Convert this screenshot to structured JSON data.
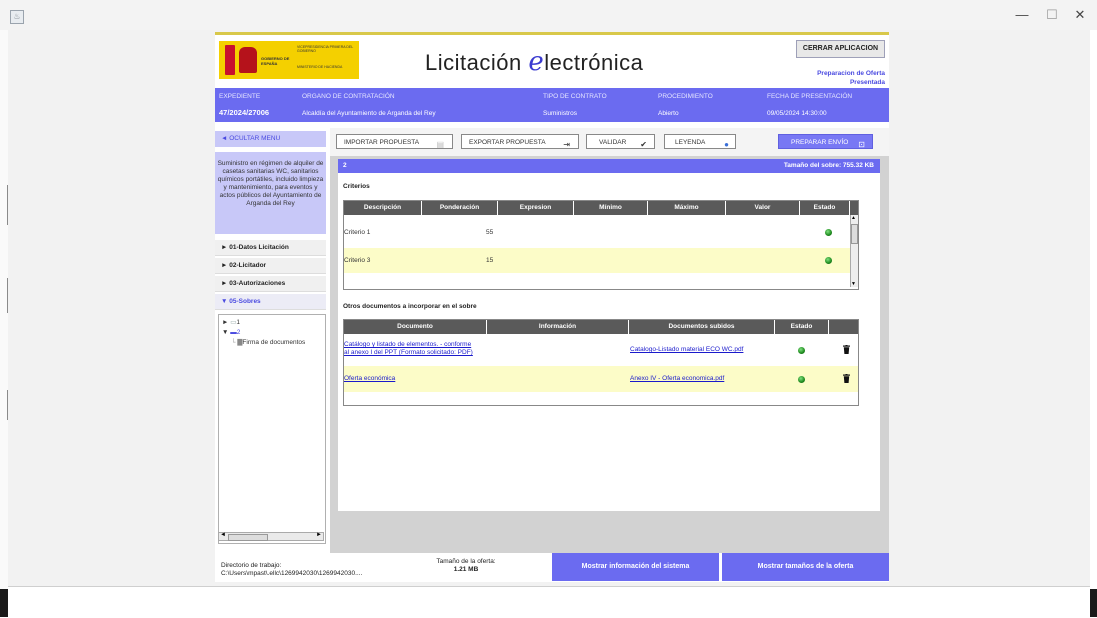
{
  "window": {
    "controls": {
      "minimize": "—",
      "maximize": "☐",
      "close": "✕"
    }
  },
  "header": {
    "logo": {
      "gob_text": "GOBIERNO DE ESPAÑA",
      "vice_text": "VICEPRESIDENCIA PRIMERA DEL GOBIERNO",
      "min_text": "MINISTERIO DE HACIENDA"
    },
    "brand_prefix": "Licitación ",
    "brand_e": "e",
    "brand_suffix": "lectrónica",
    "close_button": "CERRAR APLICACION",
    "status_line1": "Preparacion de Oferta",
    "status_line2": "Presentada"
  },
  "info": {
    "expediente_label": "EXPEDIENTE",
    "expediente_value": "47/2024/27006",
    "organo_label": "ORGANO DE CONTRATACIÓN",
    "organo_value": "Alcaldía del Ayuntamiento de Arganda del Rey",
    "tipo_label": "TIPO DE CONTRATO",
    "tipo_value": "Suministros",
    "proc_label": "PROCEDIMIENTO",
    "proc_value": "Abierto",
    "fecha_label": "FECHA DE PRESENTACIÓN",
    "fecha_value": "09/05/2024 14:30:00"
  },
  "sidebar": {
    "menu_toggle": "◄ OCULTAR MENU",
    "description": "Suministro en régimen de alquiler de casetas sanitarias WC, sanitarios químicos portátiles, incluido limpieza y mantenimiento, para eventos y actos públicos del Ayuntamiento de Arganda del Rey",
    "items": [
      {
        "label": "► 01-Datos Licitación"
      },
      {
        "label": "► 02-Licitador"
      },
      {
        "label": "► 03-Autorizaciones"
      },
      {
        "label": "▼ 05-Sobres"
      }
    ],
    "tree": {
      "node1": "1",
      "node2": "2",
      "leaf": "Firma de documentos"
    }
  },
  "toolbar": {
    "import": "IMPORTAR PROPUESTA",
    "export": "EXPORTAR PROPUESTA",
    "validate": "VALIDAR",
    "legend": "LEYENDA",
    "prepare": "PREPARAR ENVÍO"
  },
  "sobre": {
    "number": "2",
    "size_text": "Tamaño del sobre: 755.32 KB"
  },
  "criterios": {
    "title": "Criterios",
    "headers": [
      "Descripción",
      "Ponderación",
      "Expresion",
      "Mínimo",
      "Máximo",
      "Valor",
      "Estado"
    ],
    "rows": [
      {
        "descripcion": "Criterio 1",
        "ponderacion": "55"
      },
      {
        "descripcion": "Criterio 3",
        "ponderacion": "15"
      }
    ]
  },
  "documentos": {
    "title": "Otros documentos a incorporar en el sobre",
    "headers": [
      "Documento",
      "Información",
      "Documentos subidos",
      "Estado"
    ],
    "rows": [
      {
        "documento_l1": "Catálogo y listado de elementos. - conforme",
        "documento_l2": "al anexo I del PPT (Formato solicitado: PDF)",
        "subido": "Catalogo-Listado material ECO WC.pdf"
      },
      {
        "documento_l1": "Oferta económica",
        "documento_l2": "",
        "subido": "Anexo IV - Oferta economica.pdf"
      }
    ]
  },
  "footer": {
    "dir_label": "Directorio de trabajo:",
    "dir_value": "C:\\Users\\mpast\\.ellc\\1269942030\\1269942030....",
    "size_label": "Tamaño de la oferta:",
    "size_value": "1.21 MB",
    "btn_info": "Mostrar información del sistema",
    "btn_sizes": "Mostrar tamaños de la oferta"
  }
}
